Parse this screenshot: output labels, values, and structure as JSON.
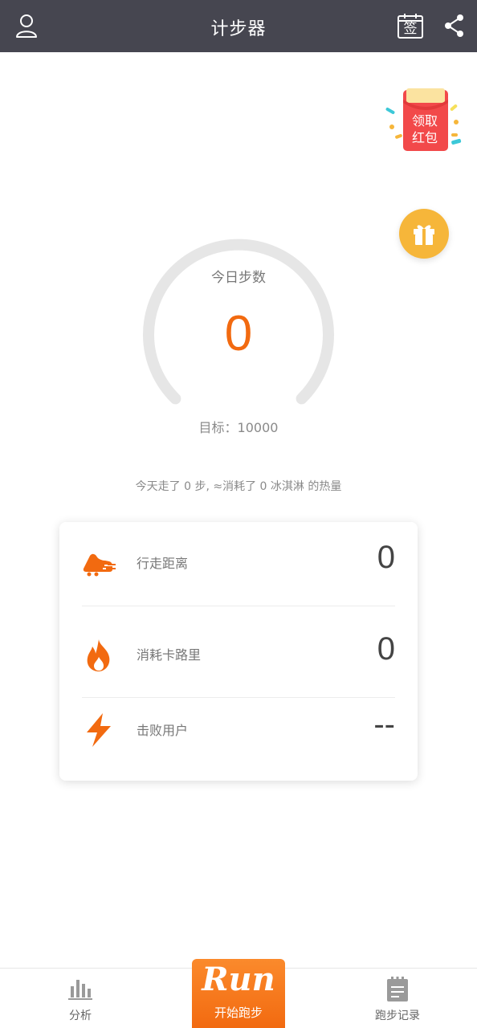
{
  "header": {
    "title": "计步器",
    "sign_text": "签"
  },
  "red_packet": {
    "line1": "领取",
    "line2": "红包"
  },
  "gauge": {
    "label": "今日步数",
    "value": "0",
    "goal_prefix": "目标：",
    "goal_value": "10000",
    "progress": 0
  },
  "summary": "今天走了 0 步, ≈消耗了 0 冰淇淋 的热量",
  "stats": [
    {
      "name": "行走距离",
      "value": "0",
      "icon": "running-shoe-icon"
    },
    {
      "name": "消耗卡路里",
      "value": "0",
      "icon": "flame-icon"
    },
    {
      "name": "击败用户",
      "value": "--",
      "icon": "lightning-icon"
    }
  ],
  "bottom_nav": {
    "analysis_label": "分析",
    "run_word": "Run",
    "run_label": "开始跑步",
    "records_label": "跑步记录"
  },
  "colors": {
    "header_bg": "#464650",
    "accent": "#f26a10",
    "gift": "#f6b63a",
    "red_packet": "#f2494a"
  }
}
